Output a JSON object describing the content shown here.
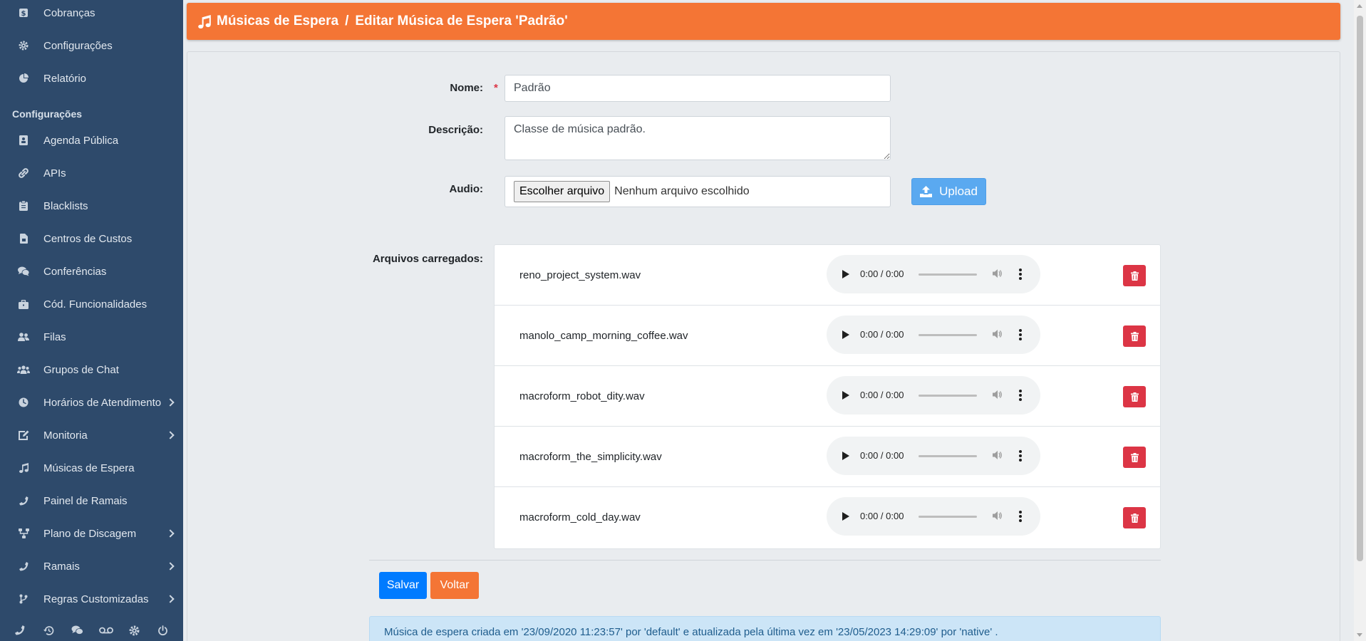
{
  "sidebar": {
    "section_label": "Configurações",
    "items": [
      {
        "label": "Cobranças",
        "icon": "dollar-icon"
      },
      {
        "label": "Configurações",
        "icon": "gear-icon"
      },
      {
        "label": "Relatório",
        "icon": "pie-chart-icon"
      },
      {
        "label": "Agenda Pública",
        "icon": "address-book-icon"
      },
      {
        "label": "APIs",
        "icon": "link-icon"
      },
      {
        "label": "Blacklists",
        "icon": "clipboard-icon"
      },
      {
        "label": "Centros de Custos",
        "icon": "file-invoice-icon"
      },
      {
        "label": "Conferências",
        "icon": "comments-icon"
      },
      {
        "label": "Cód. Funcionalidades",
        "icon": "briefcase-icon"
      },
      {
        "label": "Filas",
        "icon": "user-group-icon"
      },
      {
        "label": "Grupos de Chat",
        "icon": "users-icon"
      },
      {
        "label": "Horários de Atendimento",
        "icon": "clock-icon"
      },
      {
        "label": "Monitoria",
        "icon": "edit-icon"
      },
      {
        "label": "Músicas de Espera",
        "icon": "music-icon"
      },
      {
        "label": "Painel de Ramais",
        "icon": "phone-icon"
      },
      {
        "label": "Plano de Discagem",
        "icon": "sitemap-icon"
      },
      {
        "label": "Ramais",
        "icon": "phone-icon"
      },
      {
        "label": "Regras Customizadas",
        "icon": "code-branch-icon"
      }
    ],
    "bottom_icons": [
      "phone-icon",
      "history-icon",
      "comments-icon",
      "voicemail-icon",
      "gear-icon",
      "power-icon"
    ]
  },
  "header": {
    "section": "Músicas de Espera",
    "separator": "/",
    "page": "Editar Música de Espera 'Padrão'"
  },
  "form": {
    "nome_label": "Nome:",
    "required_mark": "*",
    "nome_value": "Padrão",
    "descricao_label": "Descrição:",
    "descricao_value": "Classe de música padrão.",
    "audio_label": "Audio:",
    "file_button": "Escolher arquivo",
    "file_none": "Nenhum arquivo escolhido",
    "upload_label": "Upload",
    "files_label": "Arquivos carregados:"
  },
  "files": [
    {
      "name": "reno_project_system.wav",
      "time": "0:00 / 0:00"
    },
    {
      "name": "manolo_camp_morning_coffee.wav",
      "time": "0:00 / 0:00"
    },
    {
      "name": "macroform_robot_dity.wav",
      "time": "0:00 / 0:00"
    },
    {
      "name": "macroform_the_simplicity.wav",
      "time": "0:00 / 0:00"
    },
    {
      "name": "macroform_cold_day.wav",
      "time": "0:00 / 0:00"
    }
  ],
  "actions": {
    "save_label": "Salvar",
    "back_label": "Voltar"
  },
  "info": "Música de espera criada em '23/09/2020 11:23:57' por 'default' e atualizada pela última vez em '23/05/2023 14:29:09' por 'native' .",
  "colors": {
    "sidebar": "#2e4a6b",
    "header": "#f47535",
    "primary": "#007bff",
    "danger": "#dc3545",
    "upload": "#5aa9f0",
    "info_bg": "#cce5f7"
  }
}
